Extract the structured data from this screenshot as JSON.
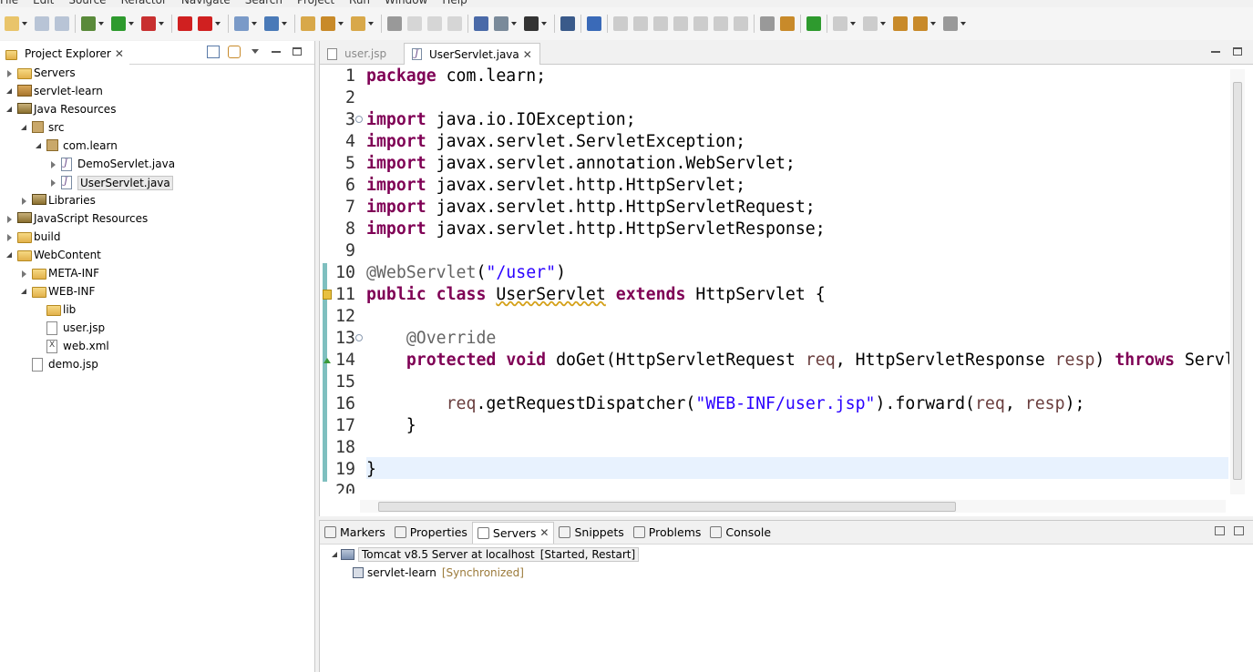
{
  "menu": [
    "File",
    "Edit",
    "Source",
    "Refactor",
    "Navigate",
    "Search",
    "Project",
    "Run",
    "Window",
    "Help"
  ],
  "explorer": {
    "title": "Project Explorer",
    "close": "✕",
    "tree": [
      {
        "label": "Servers",
        "icon": "folder-icon",
        "depth": 0,
        "state": "collapsed"
      },
      {
        "label": "servlet-learn",
        "icon": "project-icon",
        "depth": 0,
        "state": "expanded"
      },
      {
        "label": "Java Resources",
        "icon": "java-resources-icon",
        "depth": 1,
        "state": "expanded"
      },
      {
        "label": "src",
        "icon": "source-folder-icon",
        "depth": 2,
        "state": "expanded"
      },
      {
        "label": "com.learn",
        "icon": "package-icon",
        "depth": 3,
        "state": "expanded"
      },
      {
        "label": "DemoServlet.java",
        "icon": "java-file-icon",
        "depth": 4,
        "state": "collapsed"
      },
      {
        "label": "UserServlet.java",
        "icon": "java-file-icon",
        "depth": 4,
        "state": "collapsed",
        "selected": true
      },
      {
        "label": "Libraries",
        "icon": "library-icon",
        "depth": 2,
        "state": "collapsed"
      },
      {
        "label": "JavaScript Resources",
        "icon": "library-icon",
        "depth": 1,
        "state": "collapsed"
      },
      {
        "label": "build",
        "icon": "folder-icon",
        "depth": 1,
        "state": "collapsed"
      },
      {
        "label": "WebContent",
        "icon": "folder-icon",
        "depth": 1,
        "state": "expanded"
      },
      {
        "label": "META-INF",
        "icon": "folder-icon",
        "depth": 2,
        "state": "collapsed"
      },
      {
        "label": "WEB-INF",
        "icon": "folder-icon",
        "depth": 2,
        "state": "expanded"
      },
      {
        "label": "lib",
        "icon": "folder-icon",
        "depth": 3,
        "state": "leaf"
      },
      {
        "label": "user.jsp",
        "icon": "jsp-file-icon",
        "depth": 3,
        "state": "leaf"
      },
      {
        "label": "web.xml",
        "icon": "xml-file-icon",
        "depth": 3,
        "state": "leaf"
      },
      {
        "label": "demo.jsp",
        "icon": "jsp-file-icon",
        "depth": 2,
        "state": "leaf"
      }
    ]
  },
  "editor": {
    "tabs": [
      {
        "label": "user.jsp",
        "active": false
      },
      {
        "label": "UserServlet.java",
        "active": true,
        "close": "✕"
      }
    ],
    "lines": [
      [
        [
          "kw",
          "package"
        ],
        [
          "",
          " com.learn;"
        ]
      ],
      [],
      [
        [
          "kw",
          "import"
        ],
        [
          "",
          " java.io.IOException;"
        ]
      ],
      [
        [
          "kw",
          "import"
        ],
        [
          "",
          " javax.servlet.ServletException;"
        ]
      ],
      [
        [
          "kw",
          "import"
        ],
        [
          "",
          " javax.servlet.annotation.WebServlet;"
        ]
      ],
      [
        [
          "kw",
          "import"
        ],
        [
          "",
          " javax.servlet.http.HttpServlet;"
        ]
      ],
      [
        [
          "kw",
          "import"
        ],
        [
          "",
          " javax.servlet.http.HttpServletRequest;"
        ]
      ],
      [
        [
          "kw",
          "import"
        ],
        [
          "",
          " javax.servlet.http.HttpServletResponse;"
        ]
      ],
      [],
      [
        [
          "ann",
          "@WebServlet"
        ],
        [
          "",
          "("
        ],
        [
          "str",
          "\"/user\""
        ],
        [
          "",
          ")"
        ]
      ],
      [
        [
          "kw",
          "public"
        ],
        [
          "",
          " "
        ],
        [
          "kw",
          "class"
        ],
        [
          "",
          " "
        ],
        [
          "warnu",
          "UserServlet"
        ],
        [
          "",
          " "
        ],
        [
          "kw",
          "extends"
        ],
        [
          "",
          " HttpServlet {"
        ]
      ],
      [],
      [
        [
          "",
          "    "
        ],
        [
          "ann",
          "@Override"
        ]
      ],
      [
        [
          "",
          "    "
        ],
        [
          "kw",
          "protected"
        ],
        [
          "",
          " "
        ],
        [
          "kw",
          "void"
        ],
        [
          "",
          " doGet(HttpServletRequest "
        ],
        [
          "var",
          "req"
        ],
        [
          "",
          ", HttpServletResponse "
        ],
        [
          "var",
          "resp"
        ],
        [
          "",
          ") "
        ],
        [
          "kw",
          "throws"
        ],
        [
          "",
          " ServletException, IOException {"
        ]
      ],
      [],
      [
        [
          "",
          "        "
        ],
        [
          "var",
          "req"
        ],
        [
          "",
          ".getRequestDispatcher("
        ],
        [
          "str",
          "\"WEB-INF/user.jsp\""
        ],
        [
          "",
          ").forward("
        ],
        [
          "var",
          "req"
        ],
        [
          "",
          ", "
        ],
        [
          "var",
          "resp"
        ],
        [
          "",
          ");"
        ]
      ],
      [
        [
          "",
          "    }"
        ]
      ],
      [],
      [
        [
          "",
          "}"
        ]
      ],
      []
    ]
  },
  "bottom": {
    "tabs": [
      {
        "label": "Markers",
        "icon": "markers-icon"
      },
      {
        "label": "Properties",
        "icon": "properties-icon"
      },
      {
        "label": "Servers",
        "icon": "servers-icon",
        "active": true,
        "close": "✕"
      },
      {
        "label": "Snippets",
        "icon": "snippets-icon"
      },
      {
        "label": "Problems",
        "icon": "problems-icon"
      },
      {
        "label": "Console",
        "icon": "console-icon"
      }
    ],
    "servers": [
      {
        "label": "Tomcat v8.5 Server at localhost",
        "status": "[Started, Restart]"
      },
      {
        "label": "servlet-learn",
        "status": "[Synchronized]"
      }
    ]
  },
  "colors": {
    "keyword": "#7f0055",
    "string": "#2a00ff",
    "annotation": "#646464",
    "variable": "#6a3e3e"
  }
}
